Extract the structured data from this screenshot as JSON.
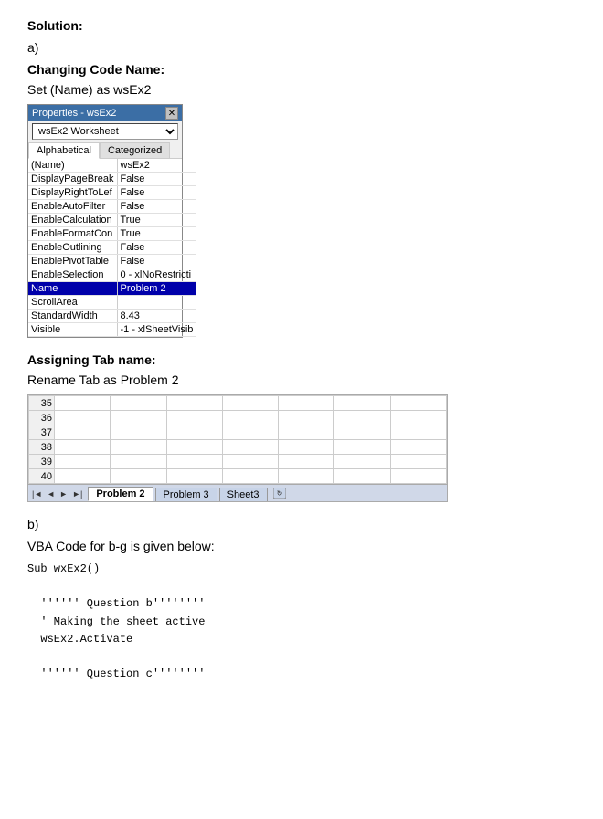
{
  "solution_label": "Solution:",
  "part_a_label": "a)",
  "changing_code_name_label": "Changing Code Name:",
  "set_name_label": "Set (Name) as wsEx2",
  "properties_window": {
    "title": "Properties - wsEx2",
    "dropdown_value": "wsEx2 Worksheet",
    "tab_alphabetical": "Alphabetical",
    "tab_categorized": "Categorized",
    "rows": [
      {
        "key": "(Name)",
        "value": "wsEx2",
        "highlighted": false
      },
      {
        "key": "DisplayPageBreak",
        "value": "False",
        "highlighted": false
      },
      {
        "key": "DisplayRightToLef",
        "value": "False",
        "highlighted": false
      },
      {
        "key": "EnableAutoFilter",
        "value": "False",
        "highlighted": false
      },
      {
        "key": "EnableCalculation",
        "value": "True",
        "highlighted": false
      },
      {
        "key": "EnableFormatCon",
        "value": "True",
        "highlighted": false
      },
      {
        "key": "EnableOutlining",
        "value": "False",
        "highlighted": false
      },
      {
        "key": "EnablePivotTable",
        "value": "False",
        "highlighted": false
      },
      {
        "key": "EnableSelection",
        "value": "0 - xlNoRestricti",
        "highlighted": false
      },
      {
        "key": "Name",
        "value": "Problem 2",
        "highlighted": true
      },
      {
        "key": "ScrollArea",
        "value": "",
        "highlighted": false
      },
      {
        "key": "StandardWidth",
        "value": "8.43",
        "highlighted": false
      },
      {
        "key": "Visible",
        "value": "-1 - xlSheetVisib",
        "highlighted": false
      }
    ]
  },
  "assigning_tab_label": "Assigning Tab name:",
  "rename_tab_label": "Rename Tab as Problem 2",
  "spreadsheet": {
    "row_numbers": [
      35,
      36,
      37,
      38,
      39,
      40
    ],
    "tabs": [
      "Problem 2",
      "Problem 3",
      "Sheet3"
    ],
    "active_tab": "Problem 2"
  },
  "part_b_label": "b)",
  "vba_intro": "VBA Code for b-g is given below:",
  "code_lines": [
    "Sub wxEx2()",
    "",
    "  '''''' Question b''''''''",
    "  ' Making the sheet active",
    "  wsEx2.Activate",
    "",
    "  '''''' Question c''''''''"
  ]
}
